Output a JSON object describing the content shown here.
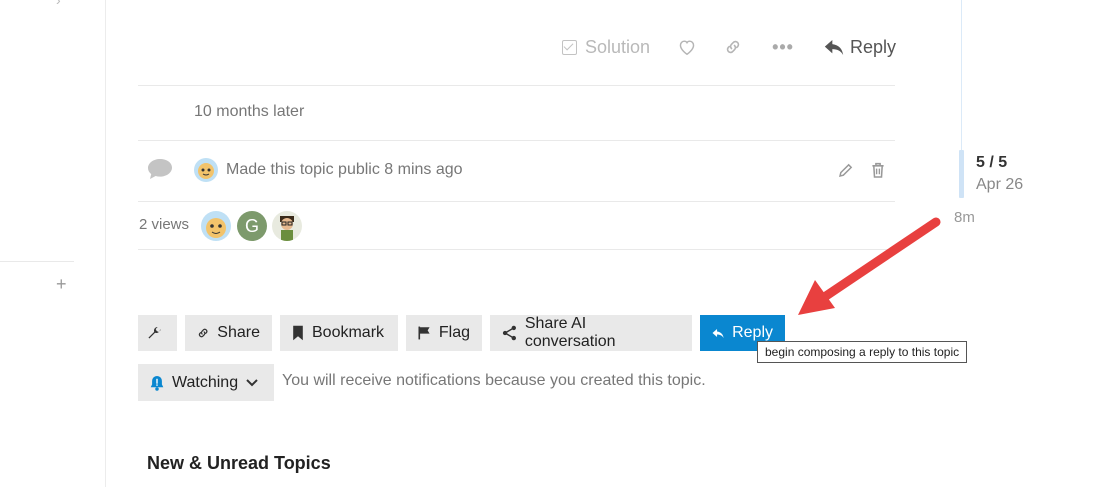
{
  "post_actions": {
    "solution_label": "Solution",
    "reply_label": "Reply"
  },
  "time_gap": "10 months later",
  "small_action": {
    "text": "Made this topic public 8 mins ago"
  },
  "topic_map": {
    "views": "2 views",
    "participants": [
      {
        "initial": ""
      },
      {
        "initial": "G"
      },
      {
        "initial": ""
      }
    ]
  },
  "timeline": {
    "count": "5 / 5",
    "date": "Apr 26",
    "now": "8m"
  },
  "footer_buttons": {
    "share": "Share",
    "bookmark": "Bookmark",
    "flag": "Flag",
    "share_ai": "Share AI conversation",
    "reply": "Reply"
  },
  "tooltip": "begin composing a reply to this topic",
  "notifications": {
    "level": "Watching",
    "reason": "You will receive notifications because you created this topic."
  },
  "suggested_heading": "New & Unread Topics",
  "colors": {
    "accent": "#0a87d0",
    "annotation_arrow": "#e8403f"
  }
}
